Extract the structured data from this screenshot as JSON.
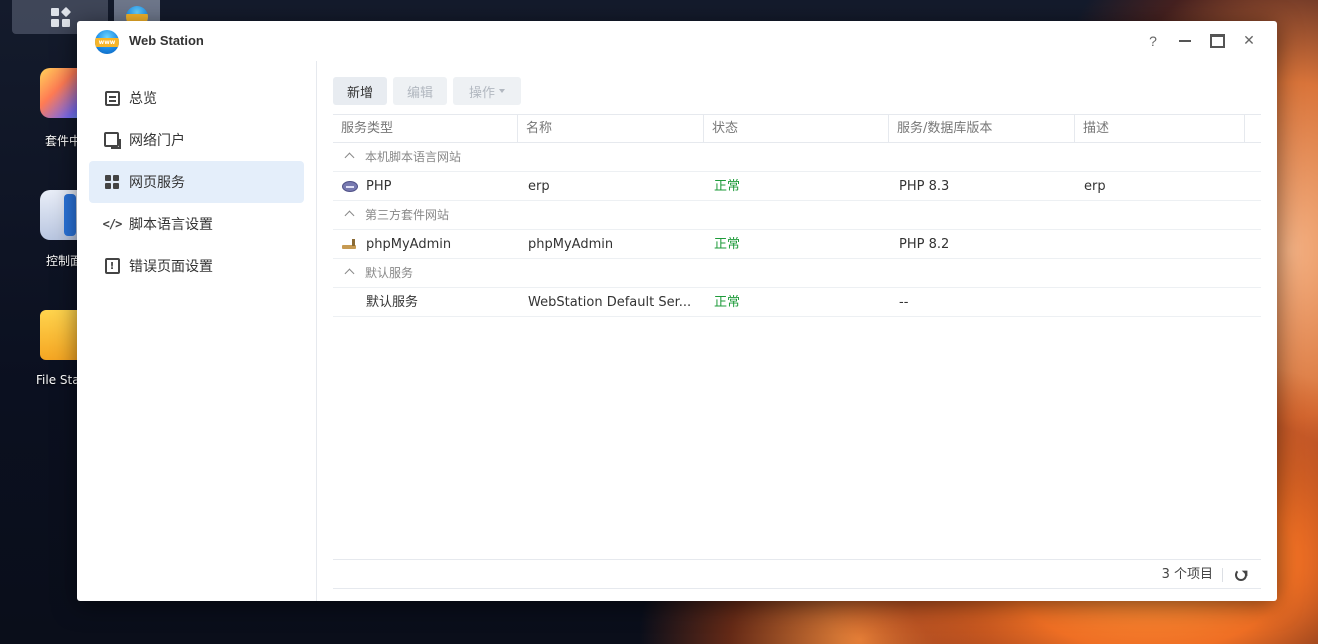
{
  "desktop": {
    "icons": [
      {
        "label": "套件中",
        "icon": "package-center-icon"
      },
      {
        "label": "控制面",
        "icon": "control-panel-icon"
      },
      {
        "label": "File Sta",
        "icon": "file-station-icon"
      }
    ]
  },
  "window": {
    "title": "Web Station",
    "help": "?",
    "close": "✕"
  },
  "sidebar": {
    "items": [
      {
        "label": "总览",
        "icon": "overview-icon",
        "active": false
      },
      {
        "label": "网络门户",
        "icon": "web-portal-icon",
        "active": false
      },
      {
        "label": "网页服务",
        "icon": "web-service-icon",
        "active": true
      },
      {
        "label": "脚本语言设置",
        "icon": "script-language-icon",
        "active": false
      },
      {
        "label": "错误页面设置",
        "icon": "error-page-icon",
        "active": false
      }
    ]
  },
  "toolbar": {
    "add": "新增",
    "edit": "编辑",
    "action": "操作"
  },
  "grid": {
    "columns": [
      "服务类型",
      "名称",
      "状态",
      "服务/数据库版本",
      "描述"
    ],
    "groups": [
      {
        "label": "本机脚本语言网站",
        "rows": [
          {
            "type": "PHP",
            "icon": "php-icon",
            "name": "erp",
            "status": "正常",
            "version": "PHP 8.3",
            "desc": "erp"
          }
        ]
      },
      {
        "label": "第三方套件网站",
        "rows": [
          {
            "type": "phpMyAdmin",
            "icon": "phpmyadmin-icon",
            "name": "phpMyAdmin",
            "status": "正常",
            "version": "PHP 8.2",
            "desc": ""
          }
        ]
      },
      {
        "label": "默认服务",
        "rows": [
          {
            "type": "默认服务",
            "icon": "",
            "name": "WebStation Default Ser...",
            "status": "正常",
            "version": "--",
            "desc": ""
          }
        ]
      }
    ]
  },
  "footer": {
    "count": "3 个项目"
  },
  "colors": {
    "status_ok": "#1e9b3a",
    "active_nav": "#e4eefa"
  }
}
